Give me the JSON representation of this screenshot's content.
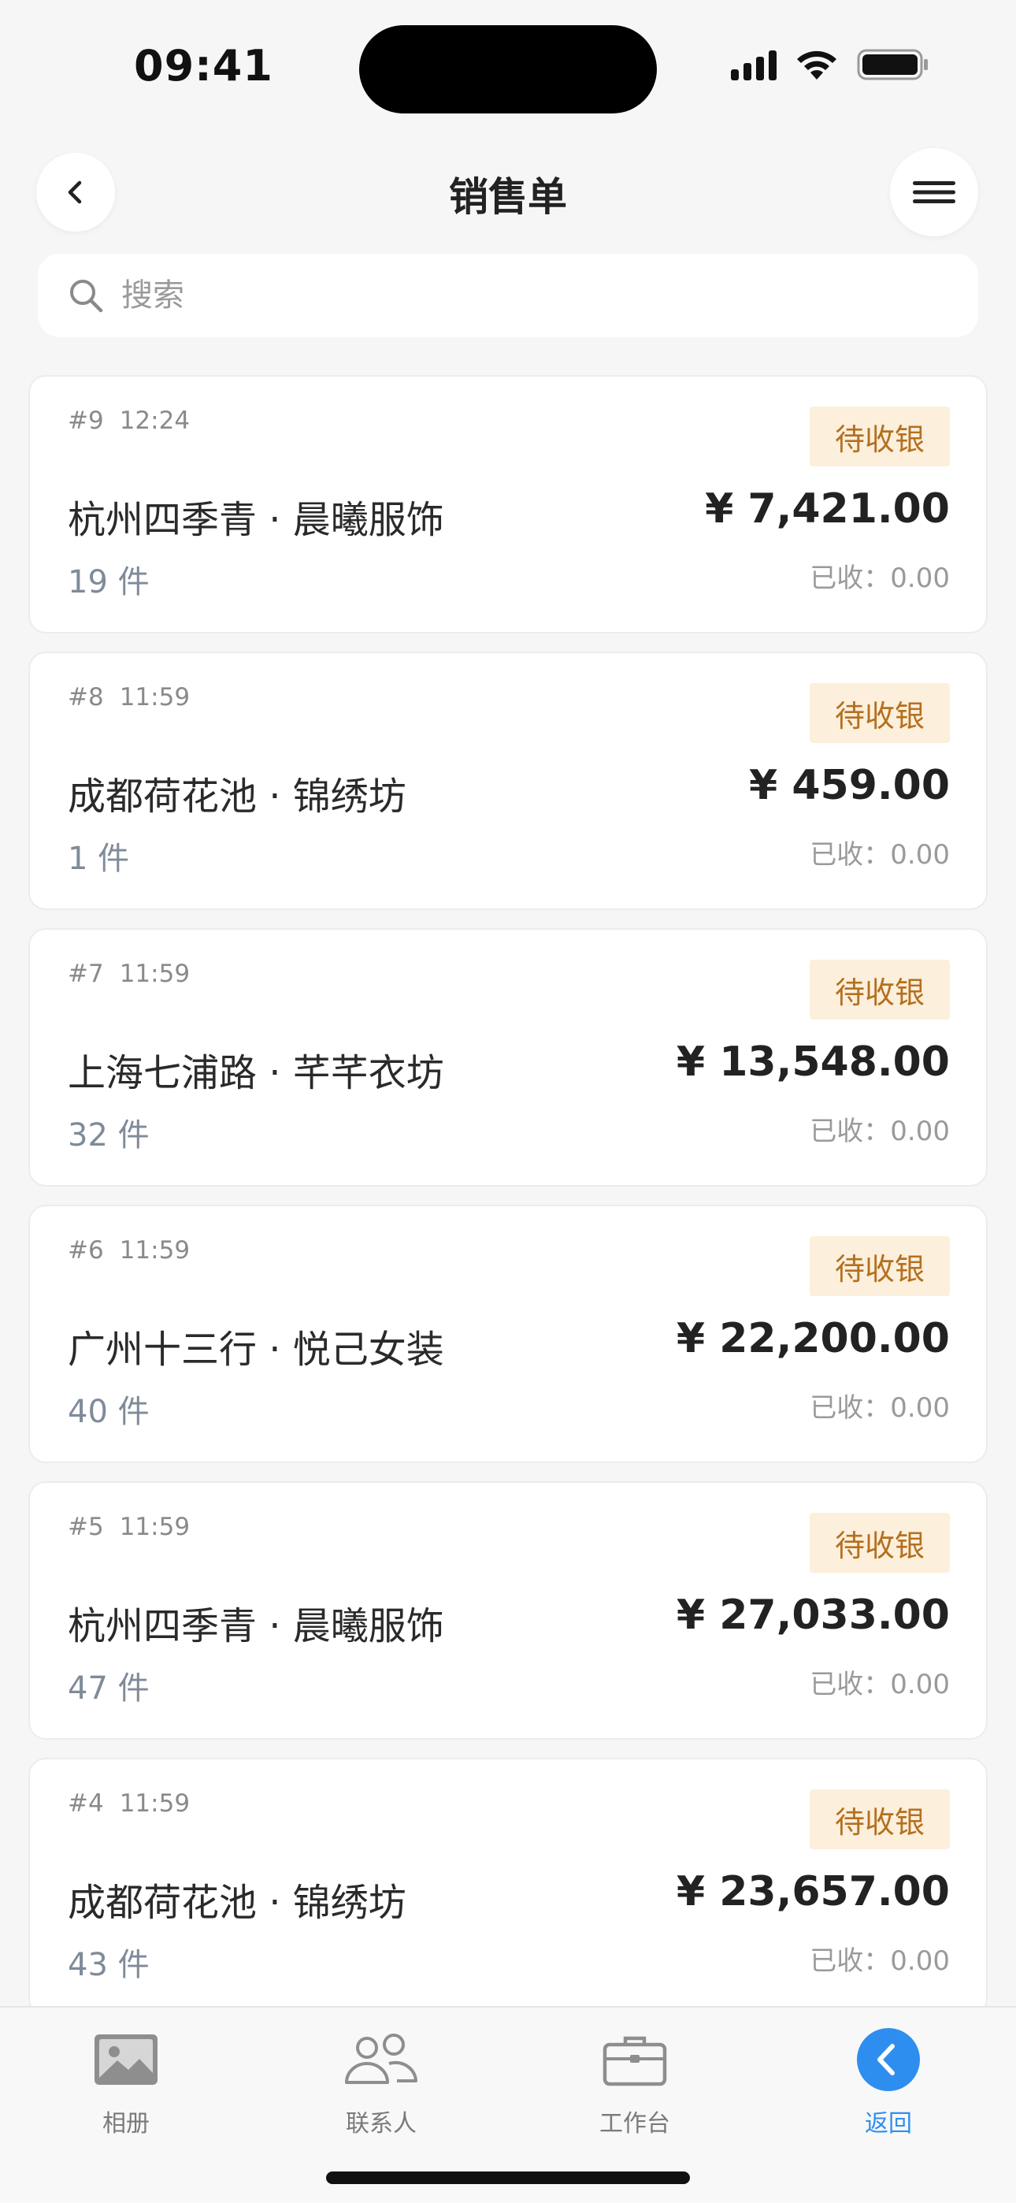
{
  "status_bar": {
    "time": "09:41"
  },
  "header": {
    "title": "销售单"
  },
  "search": {
    "placeholder": "搜索"
  },
  "orders": [
    {
      "no": "#9",
      "time": "12:24",
      "status": "待收银",
      "name": "杭州四季青 · 晨曦服饰",
      "count": "19 件",
      "amount": "¥ 7,421.00",
      "paid": "已收：0.00"
    },
    {
      "no": "#8",
      "time": "11:59",
      "status": "待收银",
      "name": "成都荷花池 · 锦绣坊",
      "count": "1 件",
      "amount": "¥ 459.00",
      "paid": "已收：0.00"
    },
    {
      "no": "#7",
      "time": "11:59",
      "status": "待收银",
      "name": "上海七浦路 · 芊芊衣坊",
      "count": "32 件",
      "amount": "¥ 13,548.00",
      "paid": "已收：0.00"
    },
    {
      "no": "#6",
      "time": "11:59",
      "status": "待收银",
      "name": "广州十三行 · 悦己女装",
      "count": "40 件",
      "amount": "¥ 22,200.00",
      "paid": "已收：0.00"
    },
    {
      "no": "#5",
      "time": "11:59",
      "status": "待收银",
      "name": "杭州四季青 · 晨曦服饰",
      "count": "47 件",
      "amount": "¥ 27,033.00",
      "paid": "已收：0.00"
    },
    {
      "no": "#4",
      "time": "11:59",
      "status": "待收银",
      "name": "成都荷花池 · 锦绣坊",
      "count": "43 件",
      "amount": "¥ 23,657.00",
      "paid": "已收：0.00"
    }
  ],
  "tabs": [
    {
      "label": "相册",
      "icon": "photo-icon"
    },
    {
      "label": "联系人",
      "icon": "contacts-icon"
    },
    {
      "label": "工作台",
      "icon": "briefcase-icon"
    },
    {
      "label": "返回",
      "icon": "back-circle-icon",
      "active": true
    }
  ],
  "colors": {
    "accent": "#2e8ef0",
    "badge_bg": "#fcefdc",
    "badge_text": "#b4701e"
  }
}
